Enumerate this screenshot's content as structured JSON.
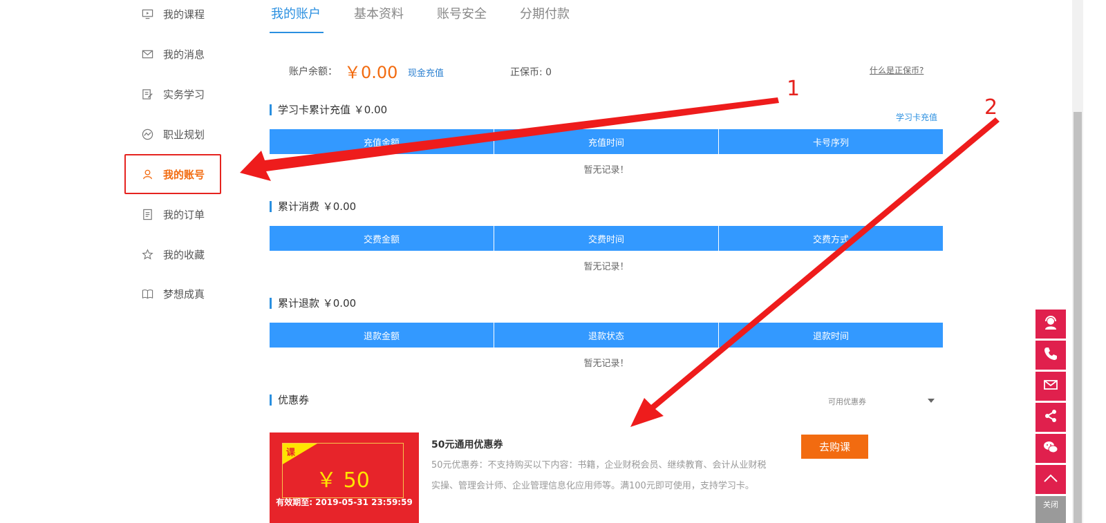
{
  "sidebar": {
    "items": [
      {
        "label": "我的课程",
        "icon": "monitor-icon"
      },
      {
        "label": "我的消息",
        "icon": "mail-icon"
      },
      {
        "label": "实务学习",
        "icon": "edit-icon"
      },
      {
        "label": "职业规划",
        "icon": "chart-icon"
      },
      {
        "label": "我的账号",
        "icon": "user-icon",
        "active": true
      },
      {
        "label": "我的订单",
        "icon": "document-icon"
      },
      {
        "label": "我的收藏",
        "icon": "star-icon"
      },
      {
        "label": "梦想成真",
        "icon": "book-icon"
      }
    ]
  },
  "tabs": [
    {
      "label": "我的账户",
      "active": true
    },
    {
      "label": "基本资料"
    },
    {
      "label": "账号安全"
    },
    {
      "label": "分期付款"
    }
  ],
  "account": {
    "balance_label": "账户余额：",
    "balance_value": "￥0.00",
    "recharge_link": "现金充值",
    "coins_label": "正保币: 0",
    "what_is_link": "什么是正保币?"
  },
  "study_card": {
    "title": "学习卡累计充值 ￥0.00",
    "recharge_link": "学习卡充值",
    "columns": [
      "充值金额",
      "充值时间",
      "卡号序列"
    ],
    "empty": "暂无记录！"
  },
  "consumption": {
    "title": "累计消费 ￥0.00",
    "columns": [
      "交费金额",
      "交费时间",
      "交费方式"
    ],
    "empty": "暂无记录！"
  },
  "refund": {
    "title": "累计退款 ￥0.00",
    "columns": [
      "退款金额",
      "退款状态",
      "退款时间"
    ],
    "empty": "暂无记录！"
  },
  "coupons": {
    "title": "优惠券",
    "filter_label": "可用优惠券",
    "items": [
      {
        "tag": "课",
        "amount": "￥ 50",
        "expire": "有效期至: 2019-05-31 23:59:59",
        "name": "50元通用优惠券",
        "desc_line1": "50元优惠券：不支持购买以下内容：书籍，企业财税会员、继续教育、会计从业财税",
        "desc_line2": "实操、管理会计师、企业管理信息化应用师等。满100元即可使用，支持学习卡。",
        "button": "去购课"
      }
    ]
  },
  "annotations": {
    "label1": "1",
    "label2": "2"
  },
  "float_bar": {
    "buttons": [
      "customer-service-icon",
      "phone-icon",
      "mail-icon",
      "share-icon",
      "wechat-icon",
      "back-to-top-icon"
    ],
    "close_label": "关闭"
  },
  "colors": {
    "accent": "#2a8fe0",
    "orange": "#f26b10",
    "table_header": "#3399ff",
    "coupon_red": "#e7242a",
    "float_red": "#e0204d",
    "annotation_red": "#e5231f"
  }
}
